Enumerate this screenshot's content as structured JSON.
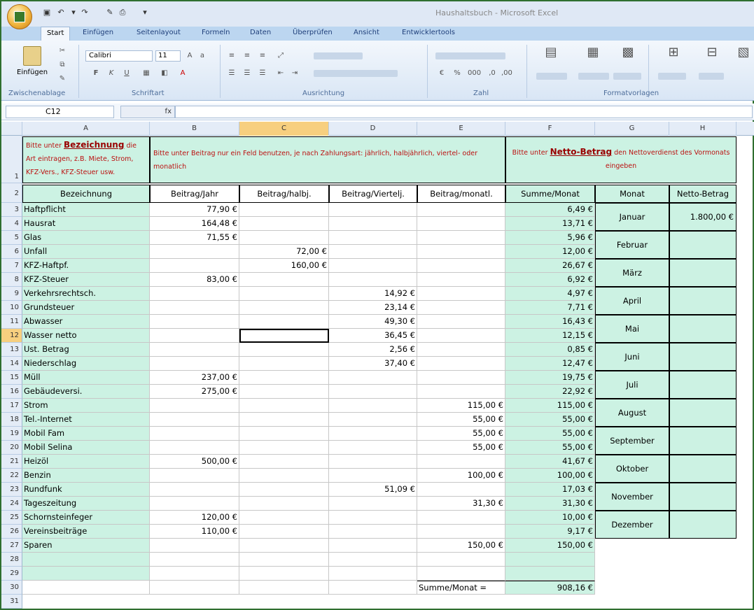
{
  "app": {
    "window_title": "Haushaltsbuch - Microsoft Excel"
  },
  "tabs": [
    "Start",
    "Einfügen",
    "Seitenlayout",
    "Formeln",
    "Daten",
    "Überprüfen",
    "Ansicht",
    "Entwicklertools"
  ],
  "ribbon": {
    "paste_label": "Einfügen",
    "font_name": "Calibri",
    "font_size": "11",
    "group_labels": [
      "Zwischenablage",
      "Schriftart",
      "Ausrichtung",
      "Zahl",
      "Formatvorlagen"
    ]
  },
  "formula_bar": {
    "name_box": "C12",
    "fx": "fx",
    "formula": ""
  },
  "columns": [
    "A",
    "B",
    "C",
    "D",
    "E",
    "F",
    "G",
    "H"
  ],
  "instructions": {
    "a1_prefix": "Bitte unter ",
    "a1_key": "Bezeichnung",
    "a1_suffix": " die Art eintragen, z.B. Miete, Strom, KFZ-Vers., KFZ-Steuer usw.",
    "b1": "Bitte unter Beitrag nur ein Feld benutzen, je nach Zahlungsart: jährlich, halbjährlich, viertel- oder monatlich",
    "f1_prefix": "Bitte unter ",
    "f1_key": "Netto-Betrag",
    "f1_suffix": " den Nettoverdienst des Vormonats eingeben"
  },
  "headers": [
    "Bezeichnung",
    "Beitrag/Jahr",
    "Beitrag/halbj.",
    "Beitrag/Viertelj.",
    "Beitrag/monatl.",
    "Summe/Monat",
    "Monat",
    "Netto-Betrag"
  ],
  "rows": [
    {
      "n": "3",
      "a": "Haftpflicht",
      "b": "77,90 €",
      "c": "",
      "d": "",
      "e": "",
      "f": "6,49 €"
    },
    {
      "n": "4",
      "a": "Hausrat",
      "b": "164,48 €",
      "c": "",
      "d": "",
      "e": "",
      "f": "13,71 €"
    },
    {
      "n": "5",
      "a": "Glas",
      "b": "71,55 €",
      "c": "",
      "d": "",
      "e": "",
      "f": "5,96 €"
    },
    {
      "n": "6",
      "a": "Unfall",
      "b": "",
      "c": "72,00 €",
      "d": "",
      "e": "",
      "f": "12,00 €"
    },
    {
      "n": "7",
      "a": "KFZ-Haftpf.",
      "b": "",
      "c": "160,00 €",
      "d": "",
      "e": "",
      "f": "26,67 €"
    },
    {
      "n": "8",
      "a": "KFZ-Steuer",
      "b": "83,00 €",
      "c": "",
      "d": "",
      "e": "",
      "f": "6,92 €"
    },
    {
      "n": "9",
      "a": "Verkehrsrechtsch.",
      "b": "",
      "c": "",
      "d": "14,92 €",
      "e": "",
      "f": "4,97 €"
    },
    {
      "n": "10",
      "a": "Grundsteuer",
      "b": "",
      "c": "",
      "d": "23,14 €",
      "e": "",
      "f": "7,71 €"
    },
    {
      "n": "11",
      "a": "Abwasser",
      "b": "",
      "c": "",
      "d": "49,30 €",
      "e": "",
      "f": "16,43 €"
    },
    {
      "n": "12",
      "a": "Wasser netto",
      "b": "",
      "c": "",
      "d": "36,45 €",
      "e": "",
      "f": "12,15 €"
    },
    {
      "n": "13",
      "a": "Ust. Betrag",
      "b": "",
      "c": "",
      "d": "2,56 €",
      "e": "",
      "f": "0,85 €"
    },
    {
      "n": "14",
      "a": "Niederschlag",
      "b": "",
      "c": "",
      "d": "37,40 €",
      "e": "",
      "f": "12,47 €"
    },
    {
      "n": "15",
      "a": "Müll",
      "b": "237,00 €",
      "c": "",
      "d": "",
      "e": "",
      "f": "19,75 €"
    },
    {
      "n": "16",
      "a": "Gebäudeversi.",
      "b": "275,00 €",
      "c": "",
      "d": "",
      "e": "",
      "f": "22,92 €"
    },
    {
      "n": "17",
      "a": "Strom",
      "b": "",
      "c": "",
      "d": "",
      "e": "115,00 €",
      "f": "115,00 €"
    },
    {
      "n": "18",
      "a": "Tel.-Internet",
      "b": "",
      "c": "",
      "d": "",
      "e": "55,00 €",
      "f": "55,00 €"
    },
    {
      "n": "19",
      "a": "Mobil Fam",
      "b": "",
      "c": "",
      "d": "",
      "e": "55,00 €",
      "f": "55,00 €"
    },
    {
      "n": "20",
      "a": "Mobil Selina",
      "b": "",
      "c": "",
      "d": "",
      "e": "55,00 €",
      "f": "55,00 €"
    },
    {
      "n": "21",
      "a": "Heizöl",
      "b": "500,00 €",
      "c": "",
      "d": "",
      "e": "",
      "f": "41,67 €"
    },
    {
      "n": "22",
      "a": "Benzin",
      "b": "",
      "c": "",
      "d": "",
      "e": "100,00 €",
      "f": "100,00 €"
    },
    {
      "n": "23",
      "a": "Rundfunk",
      "b": "",
      "c": "",
      "d": "51,09 €",
      "e": "",
      "f": "17,03 €"
    },
    {
      "n": "24",
      "a": "Tageszeitung",
      "b": "",
      "c": "",
      "d": "",
      "e": "31,30 €",
      "f": "31,30 €"
    },
    {
      "n": "25",
      "a": "Schornsteinfeger",
      "b": "120,00 €",
      "c": "",
      "d": "",
      "e": "",
      "f": "10,00 €"
    },
    {
      "n": "26",
      "a": "Vereinsbeiträge",
      "b": "110,00 €",
      "c": "",
      "d": "",
      "e": "",
      "f": "9,17 €"
    },
    {
      "n": "27",
      "a": "Sparen",
      "b": "",
      "c": "",
      "d": "",
      "e": "150,00 €",
      "f": "150,00 €"
    },
    {
      "n": "28",
      "a": "",
      "b": "",
      "c": "",
      "d": "",
      "e": "",
      "f": ""
    },
    {
      "n": "29",
      "a": "",
      "b": "",
      "c": "",
      "d": "",
      "e": "",
      "f": ""
    },
    {
      "n": "30",
      "a": "",
      "b": "",
      "c": "",
      "d": "",
      "e": "Summe/Monat =",
      "f": "908,16 €"
    },
    {
      "n": "31",
      "a": "",
      "b": "",
      "c": "",
      "d": "",
      "e": "",
      "f": ""
    }
  ],
  "months": [
    {
      "name": "Januar",
      "netto": "1.800,00 €"
    },
    {
      "name": "Februar",
      "netto": ""
    },
    {
      "name": "März",
      "netto": ""
    },
    {
      "name": "April",
      "netto": ""
    },
    {
      "name": "Mai",
      "netto": ""
    },
    {
      "name": "Juni",
      "netto": ""
    },
    {
      "name": "Juli",
      "netto": ""
    },
    {
      "name": "August",
      "netto": ""
    },
    {
      "name": "September",
      "netto": ""
    },
    {
      "name": "Oktober",
      "netto": ""
    },
    {
      "name": "November",
      "netto": ""
    },
    {
      "name": "Dezember",
      "netto": ""
    }
  ],
  "row_header_1": "1",
  "row_header_2": "2",
  "selected_cell": "C12",
  "colors": {
    "accent_green": "#ccf2e3",
    "header_blue": "#e4ecf7",
    "selection": "#f7cf7f"
  }
}
